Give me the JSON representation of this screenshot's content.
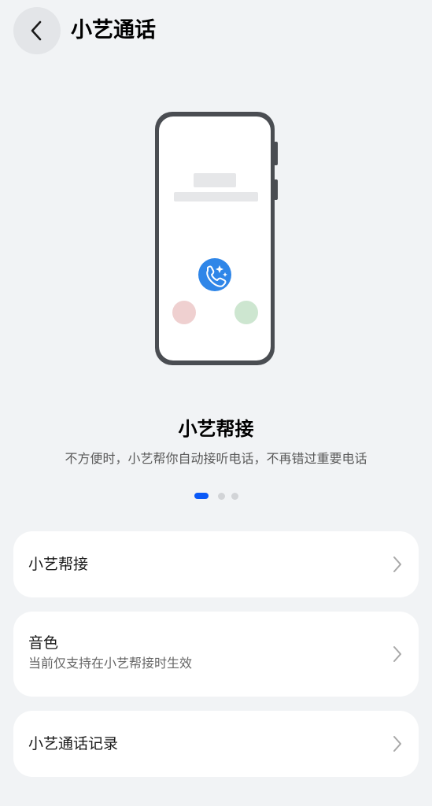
{
  "header": {
    "back_icon": "chevron-left-icon",
    "title": "小艺通话"
  },
  "carousel": {
    "feature_title": "小艺帮接",
    "feature_desc": "不方便时，小艺帮你自动接听电话，不再错过重要电话",
    "page_count": 3,
    "active_page": 1,
    "accent_color": "#0a59f7",
    "call_icon": "phone-sparkle-icon",
    "decline_color": "#efd0d0",
    "accept_color": "#cde6d0"
  },
  "settings": {
    "items": [
      {
        "label": "小艺帮接",
        "subtitle": ""
      },
      {
        "label": "音色",
        "subtitle": "当前仅支持在小艺帮接时生效"
      },
      {
        "label": "小艺通话记录",
        "subtitle": ""
      }
    ]
  }
}
